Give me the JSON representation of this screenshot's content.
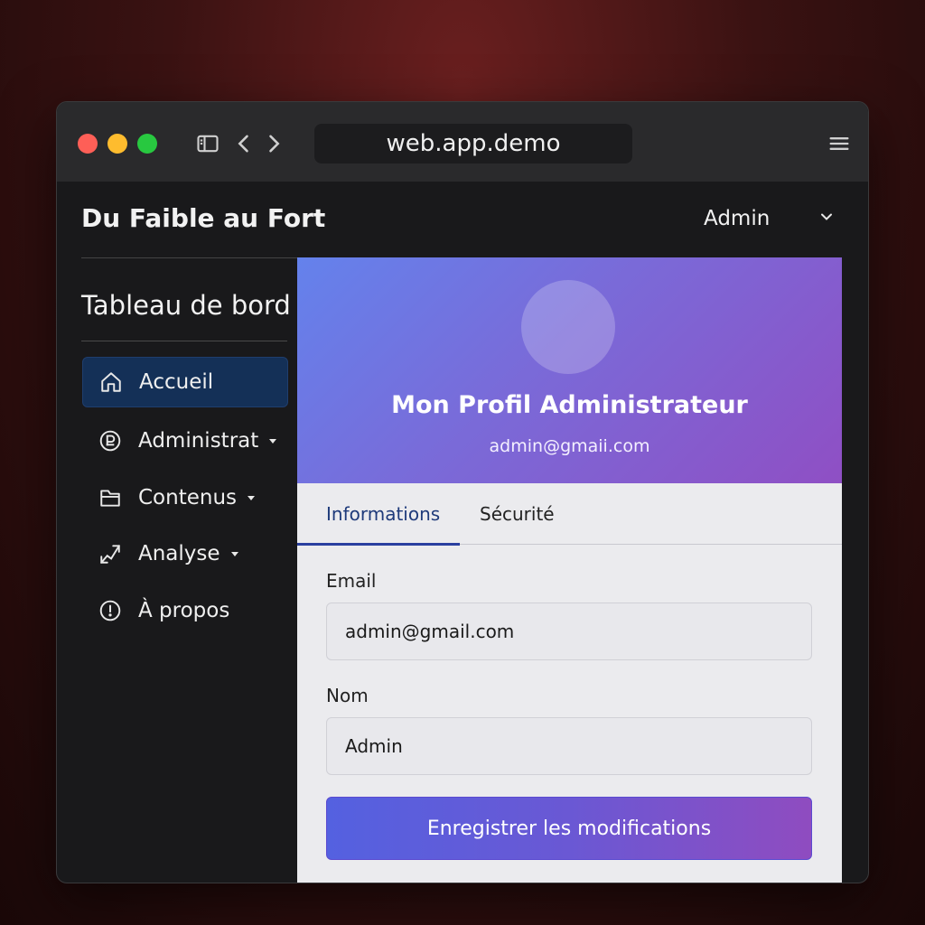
{
  "browser": {
    "url": "web.app.demo"
  },
  "app": {
    "brand": "Du Faible au Fort",
    "user_menu_label": "Admin"
  },
  "sidebar": {
    "title": "Tableau de bord",
    "items": [
      {
        "label": "Accueil",
        "icon": "home-icon",
        "active": true,
        "has_submenu": false
      },
      {
        "label": "Administrat",
        "icon": "admin-icon",
        "active": false,
        "has_submenu": true
      },
      {
        "label": "Contenus",
        "icon": "folder-icon",
        "active": false,
        "has_submenu": true
      },
      {
        "label": "Analyse",
        "icon": "analytics-icon",
        "active": false,
        "has_submenu": true
      },
      {
        "label": "À propos",
        "icon": "info-icon",
        "active": false,
        "has_submenu": false
      }
    ]
  },
  "profile": {
    "title": "Mon Profil Administrateur",
    "email": "admin@gmaii.com"
  },
  "tabs": [
    {
      "label": "Informations",
      "active": true
    },
    {
      "label": "Sécurité",
      "active": false
    }
  ],
  "form": {
    "email_label": "Email",
    "email_value": "admin@gmail.com",
    "name_label": "Nom",
    "name_value": "Admin",
    "save_label": "Enregistrer les modifications"
  },
  "colors": {
    "accent_blue": "#6482ec",
    "accent_purple": "#8f4fc4",
    "active_nav_bg": "#143057",
    "tab_active": "#1e3a7a"
  }
}
